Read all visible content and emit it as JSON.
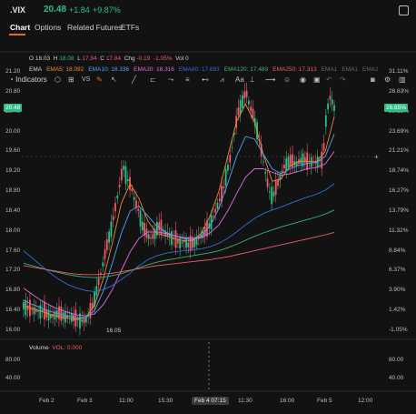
{
  "header": {
    "symbol": ".VIX",
    "price": "20.48",
    "change": "+1.84",
    "change_pct": "+9.87%"
  },
  "tabs": [
    "Chart",
    "Options",
    "Related Futures",
    "ETFs"
  ],
  "toolbar": {
    "indicators_label": "Indicators",
    "vs_label": "VS"
  },
  "ohlc": {
    "o_label": "O",
    "o": "18.03",
    "h_label": "H",
    "h": "18.08",
    "l_label": "L",
    "l": "17.84",
    "c_label": "C",
    "c": "17.84",
    "chg_label": "Chg",
    "chg": "-0.19",
    "chg_pct": "-1.05%",
    "vol_label": "Vol",
    "vol": "0"
  },
  "ema_labels": [
    {
      "text": "EMA",
      "color": "#d6d6d6"
    },
    {
      "text": "EMA5: 18.092",
      "color": "#e88a2c"
    },
    {
      "text": "EMA10: 18.336",
      "color": "#4da3ff"
    },
    {
      "text": "EMA20: 18.316",
      "color": "#e06ce0"
    },
    {
      "text": "EMA60: 17.693",
      "color": "#2f6fd6"
    },
    {
      "text": "EMA120: 17.489",
      "color": "#3bb273"
    },
    {
      "text": "EMA250: 17.313",
      "color": "#f0596a"
    },
    {
      "text": "EMA1",
      "color": "#666666"
    },
    {
      "text": "EMA1",
      "color": "#666666"
    },
    {
      "text": "EMA1",
      "color": "#666666"
    }
  ],
  "left_axis": [
    "21.20",
    "20.80",
    "20.40",
    "20.00",
    "19.60",
    "19.20",
    "18.80",
    "18.40",
    "18.00",
    "17.60",
    "17.20",
    "16.80",
    "16.40",
    "16.00"
  ],
  "right_axis": [
    "31.11%",
    "28.63%",
    "26.15%",
    "23.69%",
    "21.21%",
    "18.74%",
    "16.27%",
    "13.79%",
    "11.32%",
    "8.84%",
    "6.37%",
    "3.90%",
    "1.42%",
    "-1.05%"
  ],
  "price_tag_left": "20.48",
  "price_tag_right": "26.65%",
  "low_label": "16.05",
  "volume": {
    "title": "Volume",
    "vol_label": "VOL: 0.000",
    "left_axis": [
      "80.00",
      "40.00"
    ],
    "right_axis": [
      "80.00",
      "40.00"
    ]
  },
  "x_axis": [
    "Feb 2",
    "Feb 3",
    "11:00",
    "15:30",
    "Feb 4 07:15",
    "11:30",
    "16:00",
    "Feb 5",
    "12:00"
  ],
  "colors": {
    "up": "#2ebd85",
    "down": "#f0596a",
    "accent": "#e46b1f",
    "background": "#121212"
  },
  "chart_data": {
    "type": "candlestick",
    "ylim": [
      16.0,
      21.2
    ],
    "price_series": [
      16.5,
      16.45,
      16.42,
      16.4,
      16.38,
      16.4,
      16.33,
      16.28,
      16.3,
      16.35,
      16.31,
      16.27,
      16.29,
      16.24,
      16.22,
      16.2,
      16.18,
      16.3,
      16.5,
      16.8,
      17.1,
      17.45,
      17.8,
      18.1,
      18.5,
      18.9,
      19.3,
      19.05,
      18.9,
      18.6,
      18.4,
      18.1,
      17.95,
      17.85,
      17.9,
      18.1,
      18.05,
      17.95,
      17.9,
      17.85,
      17.8,
      17.75,
      17.8,
      17.72,
      17.75,
      17.8,
      17.9,
      17.95,
      18.05,
      18.2,
      18.4,
      18.6,
      18.8,
      19.2,
      19.5,
      20.0,
      20.4,
      20.6,
      20.8,
      20.5,
      20.3,
      20.0,
      19.6,
      19.2,
      18.8,
      18.7,
      18.9,
      19.1,
      19.3,
      19.4,
      19.4,
      19.35,
      19.4,
      19.45,
      19.38,
      19.4,
      19.35,
      19.42,
      19.4,
      20.4,
      20.7,
      20.48
    ],
    "ema_series": [
      {
        "name": "EMA5",
        "color": "#e88a2c",
        "values": [
          16.5,
          16.44,
          16.38,
          16.32,
          16.28,
          16.24,
          16.22,
          16.26,
          16.5,
          17.05,
          17.75,
          18.55,
          18.95,
          18.65,
          18.2,
          17.95,
          17.9,
          17.85,
          17.8,
          17.8,
          17.95,
          18.3,
          18.8,
          19.5,
          20.2,
          20.55,
          20.2,
          19.55,
          19.0,
          19.05,
          19.3,
          19.4,
          19.4,
          19.4,
          19.6,
          20.3
        ]
      },
      {
        "name": "EMA10",
        "color": "#4da3ff",
        "values": [
          16.6,
          16.52,
          16.45,
          16.38,
          16.33,
          16.28,
          16.25,
          16.26,
          16.4,
          16.8,
          17.35,
          17.95,
          18.4,
          18.5,
          18.3,
          18.1,
          17.98,
          17.9,
          17.85,
          17.82,
          17.88,
          18.1,
          18.45,
          18.95,
          19.5,
          19.9,
          19.85,
          19.55,
          19.25,
          19.15,
          19.25,
          19.32,
          19.36,
          19.38,
          19.5,
          19.95
        ]
      },
      {
        "name": "EMA20",
        "color": "#e06ce0",
        "values": [
          16.85,
          16.72,
          16.6,
          16.5,
          16.42,
          16.36,
          16.31,
          16.29,
          16.33,
          16.52,
          16.82,
          17.2,
          17.58,
          17.85,
          17.98,
          17.98,
          17.95,
          17.9,
          17.87,
          17.85,
          17.86,
          17.96,
          18.12,
          18.4,
          18.75,
          19.08,
          19.25,
          19.25,
          19.18,
          19.12,
          19.15,
          19.2,
          19.25,
          19.28,
          19.35,
          19.6
        ]
      },
      {
        "name": "EMA60",
        "color": "#2f6fd6",
        "values": [
          17.6,
          17.45,
          17.3,
          17.15,
          17.02,
          16.92,
          16.85,
          16.8,
          16.78,
          16.82,
          16.9,
          17.02,
          17.15,
          17.3,
          17.42,
          17.5,
          17.55,
          17.58,
          17.6,
          17.62,
          17.64,
          17.68,
          17.75,
          17.85,
          17.98,
          18.12,
          18.25,
          18.35,
          18.42,
          18.48,
          18.55,
          18.62,
          18.68,
          18.74,
          18.82,
          18.95
        ]
      },
      {
        "name": "EMA120",
        "color": "#3bb273",
        "values": [
          17.35,
          17.3,
          17.25,
          17.2,
          17.16,
          17.12,
          17.09,
          17.07,
          17.06,
          17.07,
          17.1,
          17.14,
          17.2,
          17.26,
          17.32,
          17.37,
          17.41,
          17.44,
          17.47,
          17.5,
          17.53,
          17.56,
          17.6,
          17.66,
          17.73,
          17.81,
          17.89,
          17.96,
          18.02,
          18.08,
          18.13,
          18.18,
          18.23,
          18.28,
          18.34,
          18.42
        ]
      },
      {
        "name": "EMA250",
        "color": "#f0596a",
        "values": [
          17.3,
          17.27,
          17.24,
          17.21,
          17.18,
          17.15,
          17.13,
          17.12,
          17.12,
          17.13,
          17.15,
          17.18,
          17.21,
          17.24,
          17.27,
          17.3,
          17.32,
          17.34,
          17.36,
          17.38,
          17.4,
          17.42,
          17.45,
          17.48,
          17.52,
          17.56,
          17.6,
          17.64,
          17.68,
          17.72,
          17.76,
          17.8,
          17.84,
          17.88,
          17.92,
          17.97
        ]
      }
    ]
  }
}
